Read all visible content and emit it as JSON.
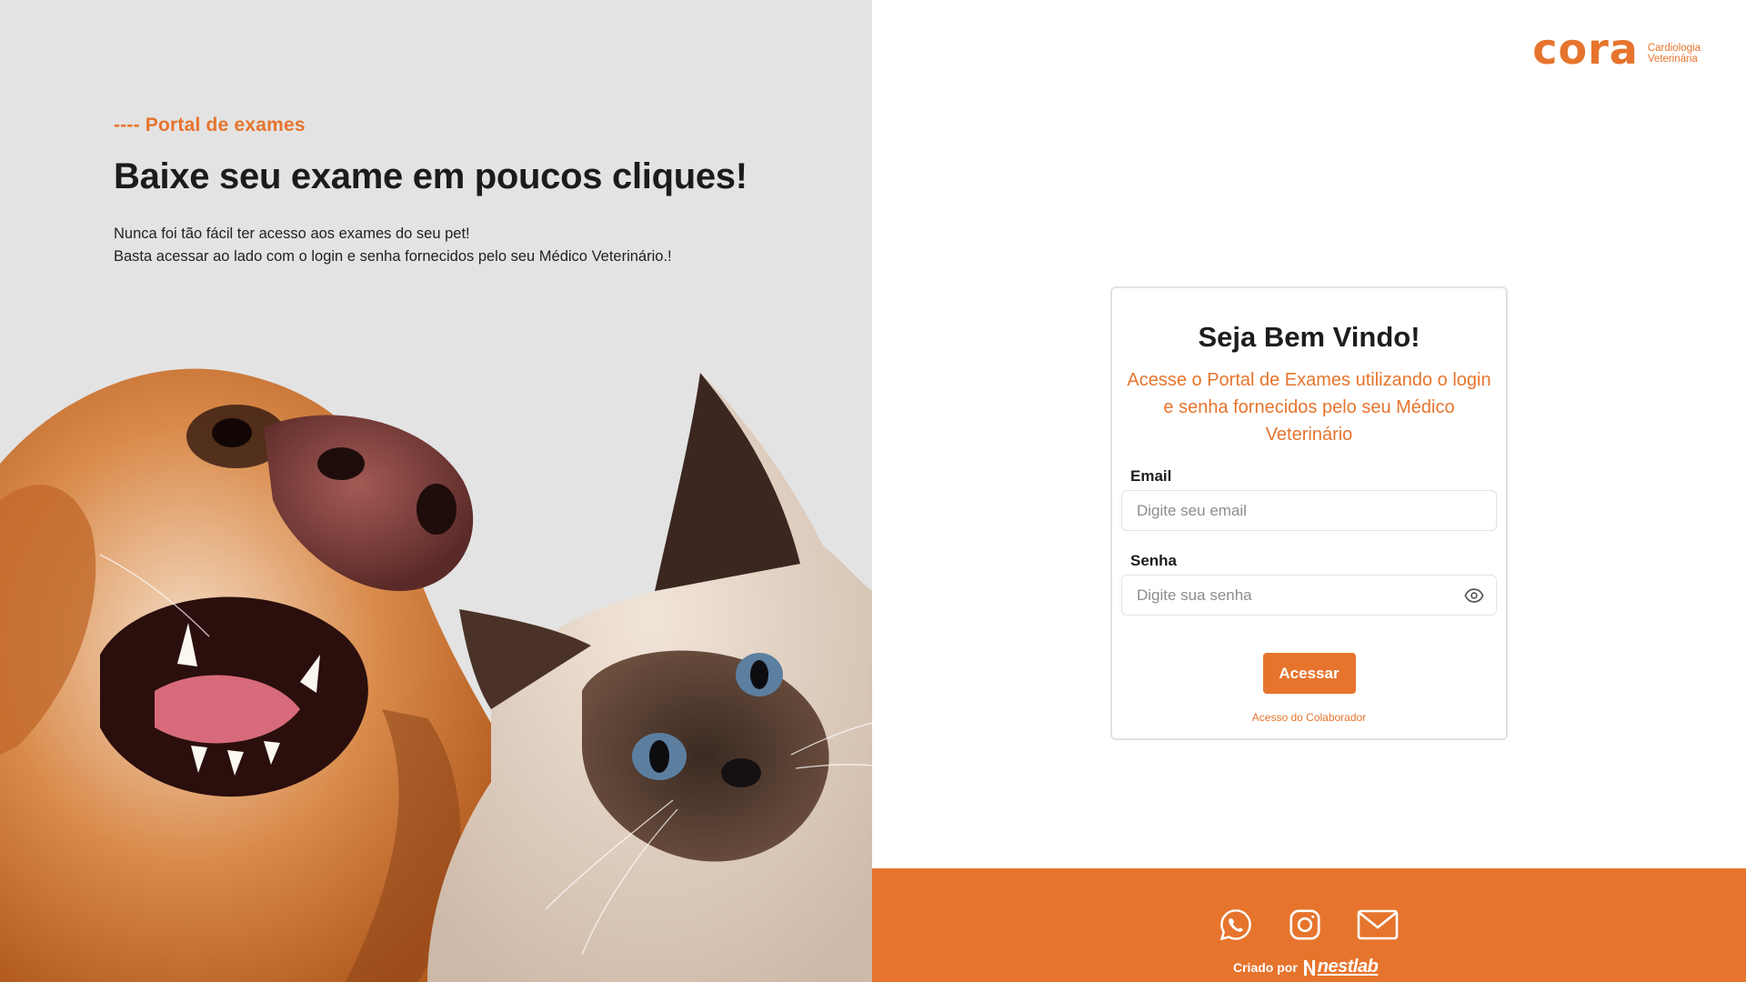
{
  "hero": {
    "kicker": "---- Portal de exames",
    "headline": "Baixe seu exame em poucos cliques!",
    "lead_line1": "Nunca foi tão fácil ter acesso aos exames do seu pet!",
    "lead_line2": "Basta acessar ao lado com o login e senha fornecidos pelo seu Médico Veterinário.!"
  },
  "brand": {
    "name": "cora",
    "tag_line1": "Cardiologia",
    "tag_line2": "Veterinária",
    "color": "#e6742d"
  },
  "login": {
    "title": "Seja Bem Vindo!",
    "subtitle": "Acesse o Portal de Exames utilizando o login e senha fornecidos pelo seu Médico Veterinário",
    "email_label": "Email",
    "email_placeholder": "Digite seu email",
    "email_value": "",
    "password_label": "Senha",
    "password_placeholder": "Digite sua senha",
    "password_value": "",
    "submit_label": "Acessar",
    "collab_link": "Acesso do Colaborador"
  },
  "footer": {
    "icons": [
      "whatsapp-icon",
      "instagram-icon",
      "mail-icon"
    ],
    "credit_text": "Criado por",
    "credit_brand": "nestlab",
    "background": "#e6742d"
  }
}
